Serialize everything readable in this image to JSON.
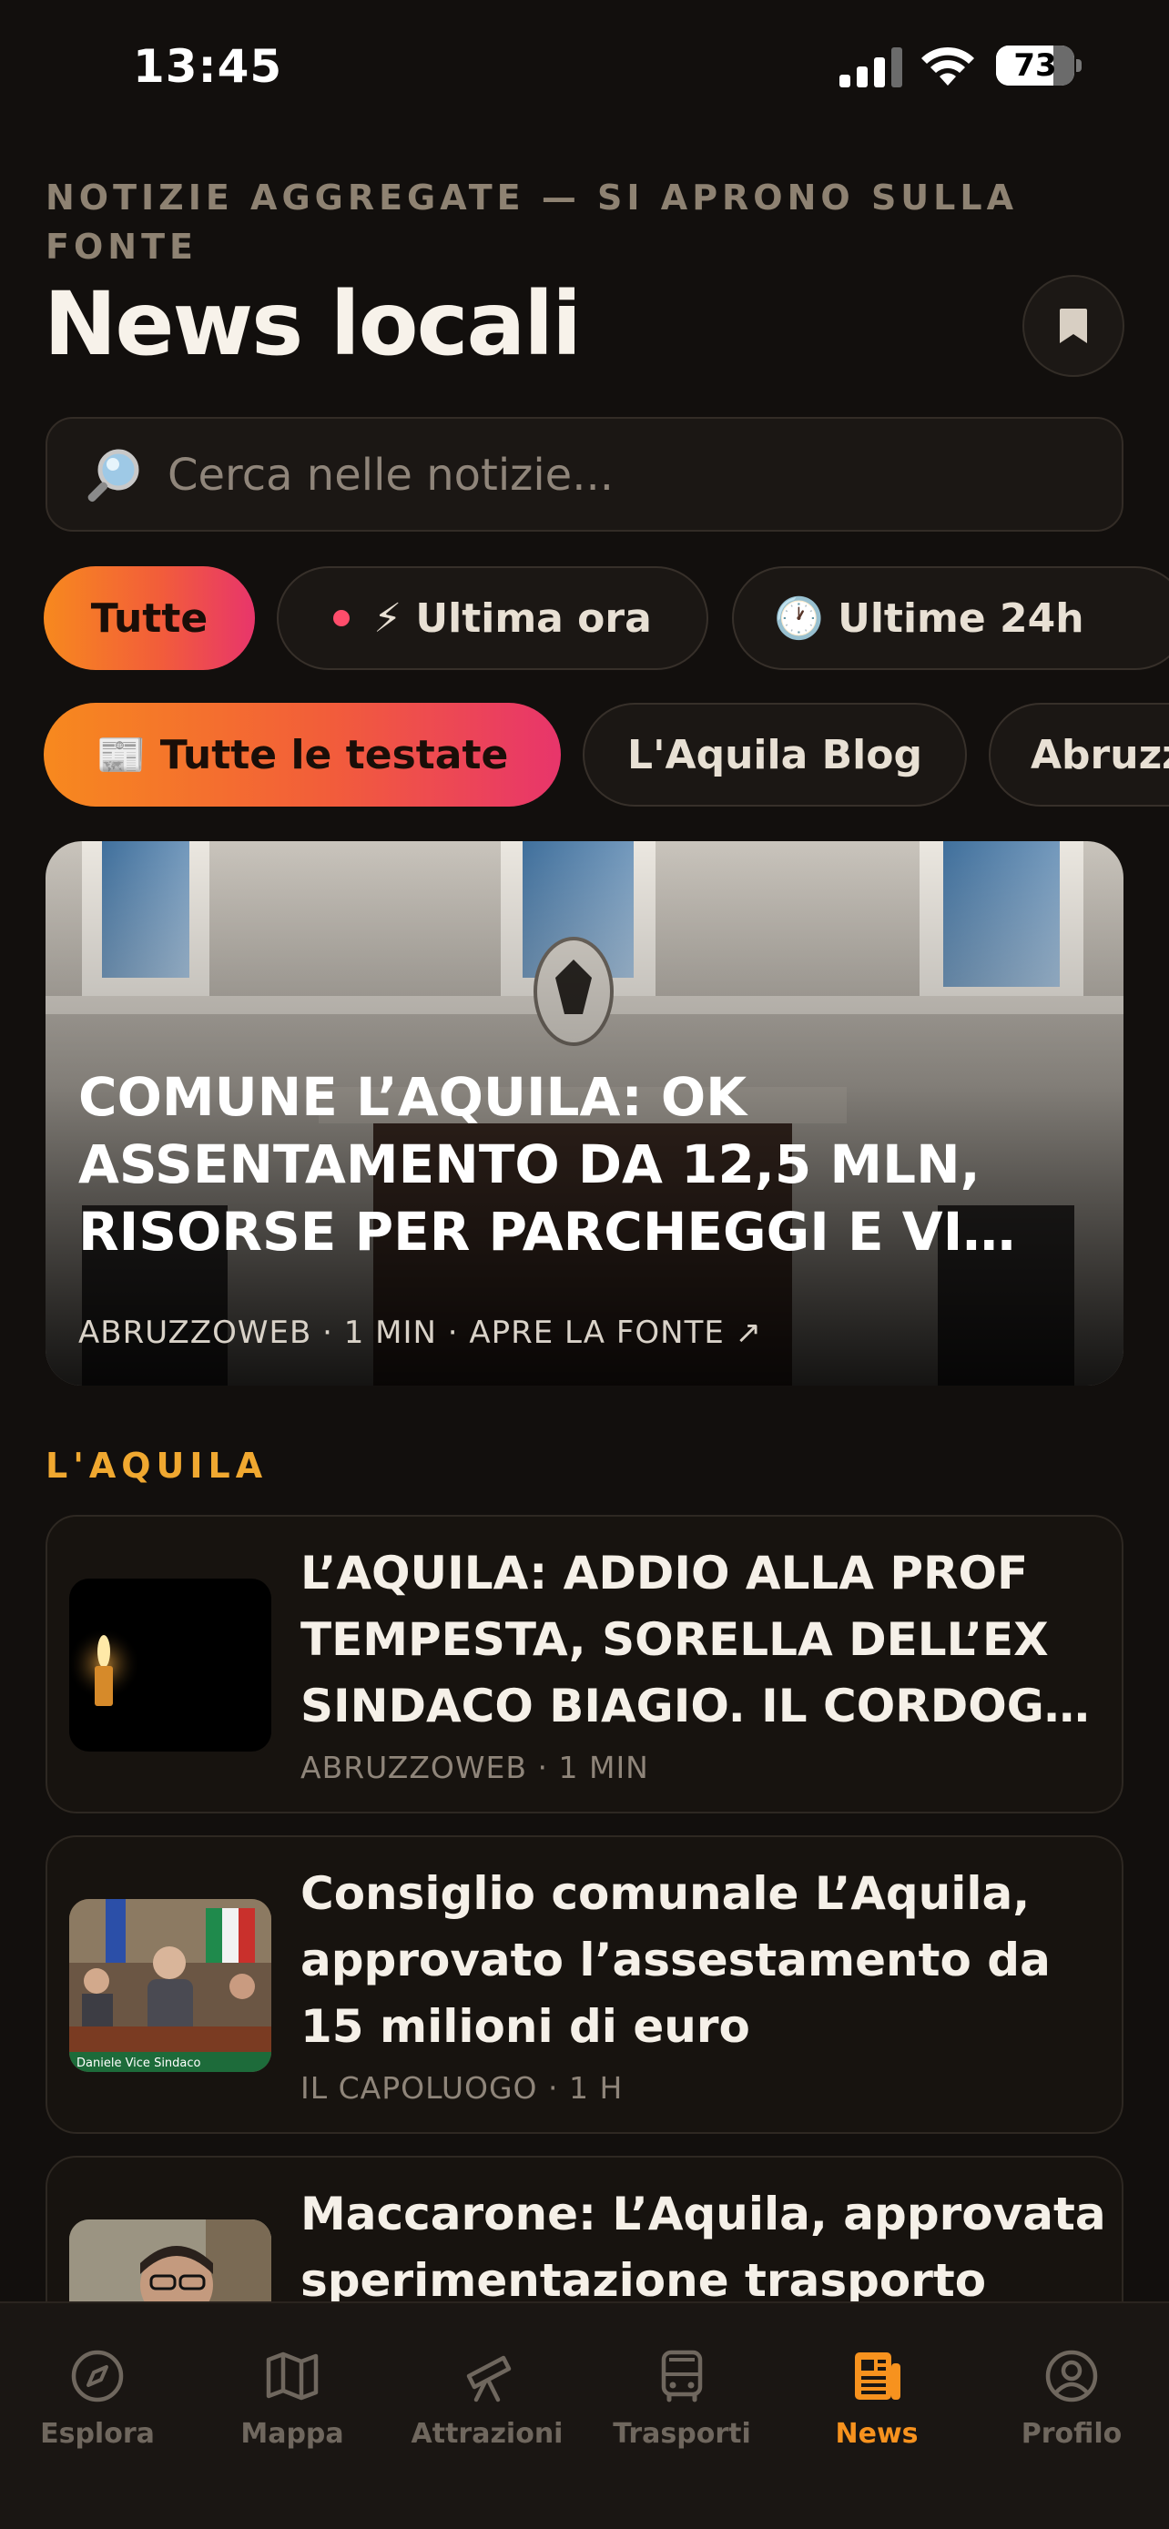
{
  "status_bar": {
    "time": "13:45",
    "battery": "73",
    "battery_level": 0.73
  },
  "header": {
    "kicker": "NOTIZIE AGGREGATE — SI APRONO SULLA FONTE",
    "title": "News locali",
    "bookmark_icon": "bookmark-icon"
  },
  "search": {
    "placeholder": "Cerca nelle notizie...",
    "value": "",
    "icon": "magnifier-icon"
  },
  "time_filters": [
    {
      "label": "Tutte",
      "active": true
    },
    {
      "label": "⚡ Ultima ora",
      "active": false,
      "dot_color": "#ff4d6b"
    },
    {
      "label": "🕐 Ultime 24h",
      "active": false
    }
  ],
  "source_filters": [
    {
      "label": "📰 Tutte le testate",
      "active": true
    },
    {
      "label": "L'Aquila Blog",
      "active": false
    },
    {
      "label": "Abruzzo",
      "active": false
    }
  ],
  "hero": {
    "title": "COMUNE L’AQUILA: OK ASSENTAMENTO DA 12,5 MLN, RISORSE PER PARCHEGGI E VI…",
    "meta": "ABRUZZOWEB · 1 MIN · APRE LA FONTE ↗"
  },
  "section": {
    "label": "L'AQUILA"
  },
  "articles": [
    {
      "title": "L’AQUILA: ADDIO ALLA PROF TEMPESTA, SORELLA DELL’EX SINDACO BIAGIO. IL CORDOG…",
      "meta": "ABRUZZOWEB · 1 MIN",
      "thumb": "candle"
    },
    {
      "title": "Consiglio comunale L’Aquila, approvato l’assestamento da 15 milioni di euro",
      "meta": "IL CAPOLUOGO · 1 H",
      "thumb": "council",
      "caption": "Daniele    Vice Sindaco"
    },
    {
      "title": "Maccarone: L’Aquila, approvata sperimentazione trasporto",
      "meta": "",
      "thumb": "portrait"
    }
  ],
  "tabbar": [
    {
      "label": "Esplora",
      "icon": "compass-icon",
      "active": false
    },
    {
      "label": "Mappa",
      "icon": "map-icon",
      "active": false
    },
    {
      "label": "Attrazioni",
      "icon": "telescope-icon",
      "active": false
    },
    {
      "label": "Trasporti",
      "icon": "bus-icon",
      "active": false
    },
    {
      "label": "News",
      "icon": "newspaper-icon",
      "active": true
    },
    {
      "label": "Profilo",
      "icon": "profile-icon",
      "active": false
    }
  ],
  "colors": {
    "accent": "#f7921e",
    "accent_pink": "#e8356b",
    "section_label": "#f0a830",
    "background": "#120f0d"
  }
}
